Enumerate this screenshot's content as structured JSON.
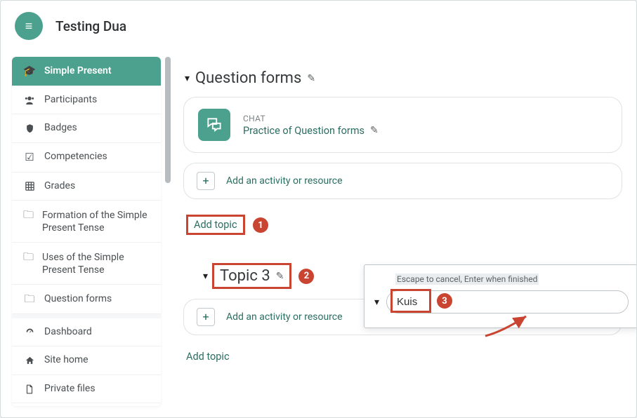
{
  "header": {
    "title": "Testing Dua"
  },
  "sidebar": {
    "items": [
      {
        "label": "Simple Present",
        "icon": "graduation-cap-icon",
        "active": true
      },
      {
        "label": "Participants",
        "icon": "users-icon"
      },
      {
        "label": "Badges",
        "icon": "shield-icon"
      },
      {
        "label": "Competencies",
        "icon": "check-square-icon"
      },
      {
        "label": "Grades",
        "icon": "grid-icon"
      },
      {
        "label": "Formation of the Simple Present Tense",
        "icon": "folder-icon"
      },
      {
        "label": "Uses of the Simple Present Tense",
        "icon": "folder-icon"
      },
      {
        "label": "Question forms",
        "icon": "folder-icon"
      }
    ],
    "footer": [
      {
        "label": "Dashboard",
        "icon": "gauge-icon"
      },
      {
        "label": "Site home",
        "icon": "home-icon"
      },
      {
        "label": "Private files",
        "icon": "file-icon"
      }
    ]
  },
  "main": {
    "section1": {
      "title": "Question forms"
    },
    "activity": {
      "type_label": "CHAT",
      "title": "Practice of Question forms"
    },
    "add_activity_label": "Add an activity or resource",
    "add_topic_label": "Add topic",
    "section2": {
      "title": "Topic 3"
    }
  },
  "edit_panel": {
    "hint": "Escape to cancel, Enter when finished",
    "value": "Kuis"
  },
  "annotations": {
    "marker1": "1",
    "marker2": "2",
    "marker3": "3"
  }
}
